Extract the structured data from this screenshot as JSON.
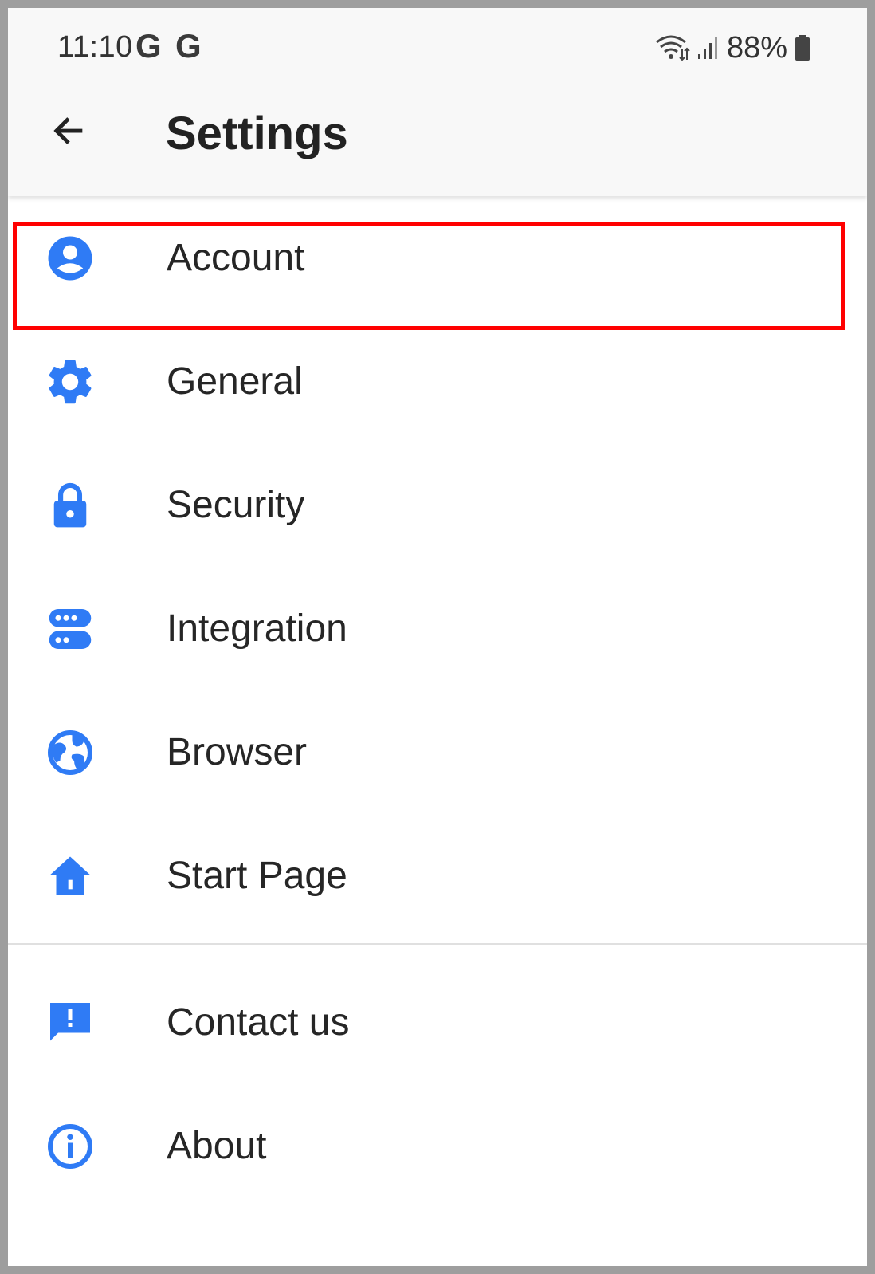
{
  "status_bar": {
    "time": "11:10",
    "notification_icons": [
      "G",
      "G"
    ],
    "battery": "88%"
  },
  "app_bar": {
    "back_icon": "arrow-left-icon",
    "title": "Settings"
  },
  "settings": {
    "items": [
      {
        "label": "Account",
        "icon": "account-circle-icon"
      },
      {
        "label": "General",
        "icon": "gear-icon"
      },
      {
        "label": "Security",
        "icon": "lock-icon"
      },
      {
        "label": "Integration",
        "icon": "dns-icon"
      },
      {
        "label": "Browser",
        "icon": "globe-icon"
      },
      {
        "label": "Start Page",
        "icon": "home-icon"
      }
    ],
    "secondary_items": [
      {
        "label": "Contact us",
        "icon": "feedback-icon"
      },
      {
        "label": "About",
        "icon": "info-icon"
      }
    ]
  },
  "highlighted_item": "Account",
  "colors": {
    "accent": "#2f7bf5",
    "highlight_border": "#ff0000",
    "text": "#262626",
    "app_bar_bg": "#f8f8f8"
  }
}
